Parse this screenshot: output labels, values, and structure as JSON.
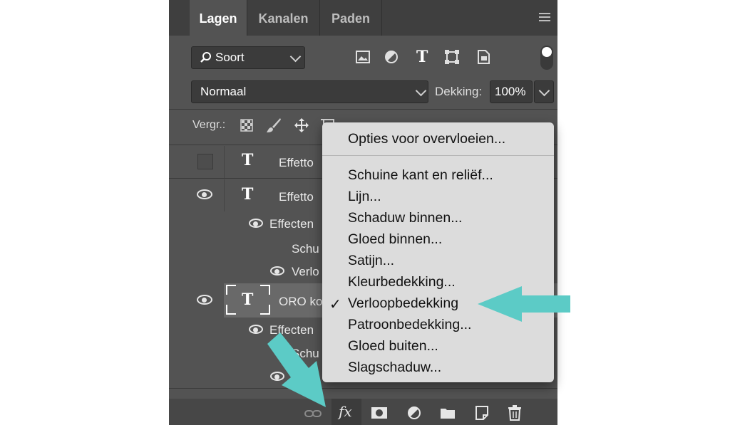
{
  "tabs": [
    "Lagen",
    "Kanalen",
    "Paden"
  ],
  "filter": {
    "label": "Soort"
  },
  "blend_mode": "Normaal",
  "opacity": {
    "label": "Dekking:",
    "value": "100%"
  },
  "lock_label": "Vergr.:",
  "layers": [
    {
      "name": "Effetto"
    },
    {
      "name": "Effetto"
    },
    {
      "name": "Effecten"
    },
    {
      "name": "Schu"
    },
    {
      "name": "Verlo"
    },
    {
      "name": "ORO ko"
    },
    {
      "name": "Effecten"
    },
    {
      "name": "Schu"
    }
  ],
  "layer_icon_glyph": "T",
  "fx_label": "fx",
  "menu": {
    "header": "Opties voor overvloeien...",
    "items": [
      "Schuine kant en reliëf...",
      "Lijn...",
      "Schaduw binnen...",
      "Gloed binnen...",
      "Satijn...",
      "Kleurbedekking...",
      "Verloopbedekking",
      "Patroonbedekking...",
      "Gloed buiten...",
      "Slagschaduw..."
    ],
    "checked_index": 6,
    "check_mark": "✓"
  },
  "colors": {
    "panel": "#535353",
    "tabbar": "#3f3f3f",
    "menu_bg": "#dcdcdc",
    "arrow": "#5ccbc6"
  }
}
